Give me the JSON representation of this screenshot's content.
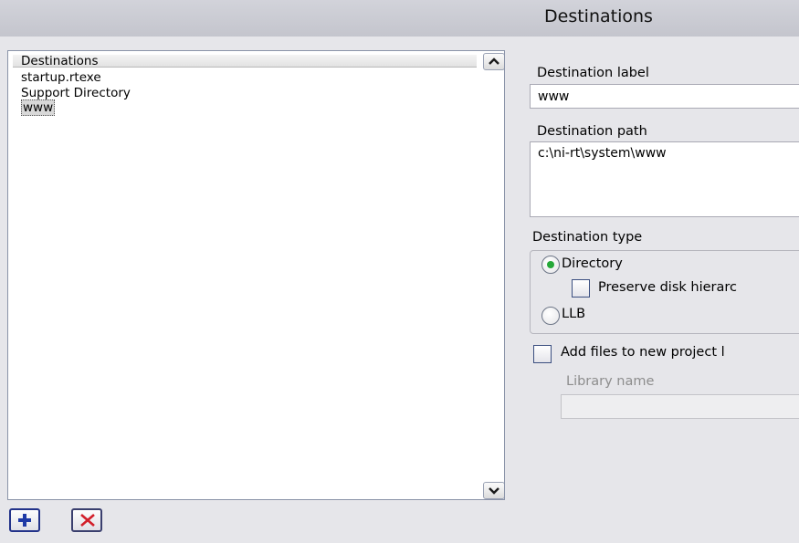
{
  "header": {
    "title": "Destinations"
  },
  "destinations_list": {
    "column_header": "Destinations",
    "items": [
      {
        "label": "startup.rtexe"
      },
      {
        "label": "Support Directory"
      },
      {
        "label": "www",
        "selected": true
      }
    ]
  },
  "icons": {
    "scroll_up": "chevron-up-icon",
    "scroll_down": "chevron-down-icon",
    "add": "plus-icon",
    "delete": "x-icon"
  },
  "colors": {
    "add_icon": "#1f3aa6",
    "delete_icon": "#d21f2a",
    "radio_selected": "#25a838"
  },
  "form": {
    "destination_label": {
      "label": "Destination label",
      "value": "www"
    },
    "destination_path": {
      "label": "Destination path",
      "value": "c:\\ni-rt\\system\\www"
    },
    "destination_type": {
      "label": "Destination type",
      "options": [
        {
          "label": "Directory",
          "selected": true
        },
        {
          "label": "LLB",
          "selected": false
        }
      ],
      "preserve_label": "Preserve disk hierarc",
      "preserve_checked": false
    },
    "add_files": {
      "label": "Add files to new project l",
      "checked": false
    },
    "library_name": {
      "label": "Library name",
      "value": ""
    }
  }
}
